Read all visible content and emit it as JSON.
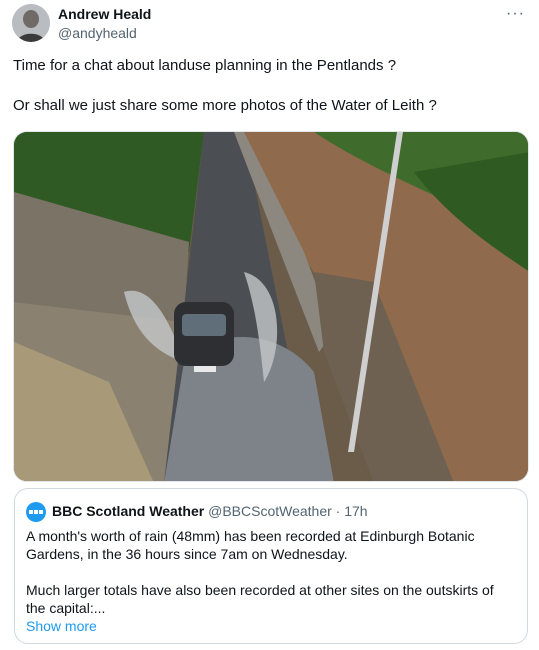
{
  "tweet": {
    "author_name": "Andrew Heald",
    "author_handle": "@andyheald",
    "more_icon": "···",
    "paragraphs": [
      "Time for a chat about landuse planning in the Pentlands ?",
      "Or shall we just share some more photos of the Water of Leith ?"
    ]
  },
  "quote": {
    "author_name": "BBC Scotland Weather",
    "author_handle": "@BBCScotWeather",
    "separator": "·",
    "time": "17h",
    "paragraphs": [
      "A month's worth of rain (48mm) has been recorded at Edinburgh Botanic Gardens, in the 36 hours since 7am on Wednesday.",
      "Much larger totals have also been recorded at other sites on the outskirts of the capital:..."
    ],
    "show_more": "Show more"
  },
  "colors": {
    "text": "#0f1419",
    "secondary": "#536471",
    "link": "#1d9bf0",
    "border": "#cfd9de"
  },
  "icons": {
    "more": "more-icon",
    "avatar": "avatar",
    "quote_avatar": "bbc-logo-icon"
  }
}
